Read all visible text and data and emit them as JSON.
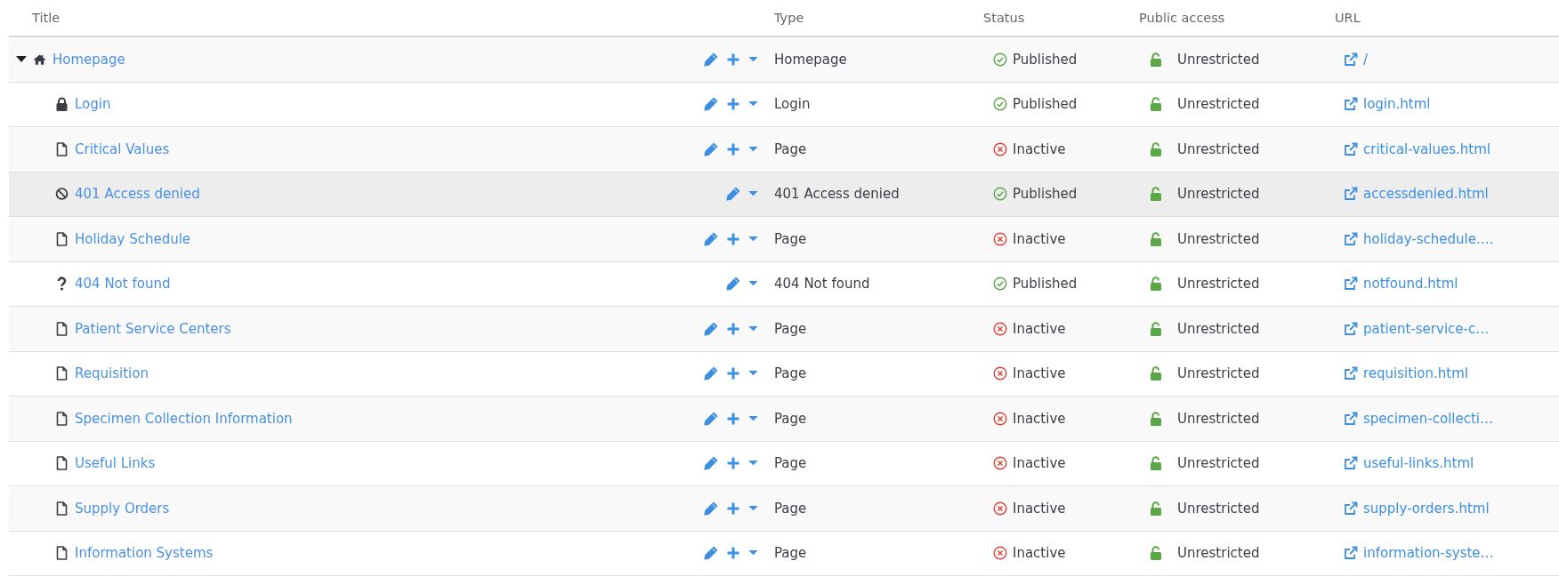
{
  "table": {
    "columns": [
      "Title",
      "Type",
      "Status",
      "Public access",
      "URL"
    ],
    "rows": [
      {
        "title": "Homepage",
        "kind": "home",
        "expanded": true,
        "can_add": true,
        "hovered": false,
        "type": "Homepage",
        "status": {
          "kind": "published",
          "label": "Published"
        },
        "access": "Unrestricted",
        "url": "/",
        "children": [
          {
            "title": "Login",
            "kind": "lock",
            "can_add": true,
            "hovered": false,
            "type": "Login",
            "status": {
              "kind": "published",
              "label": "Published"
            },
            "access": "Unrestricted",
            "url": "login.html"
          },
          {
            "title": "Critical Values",
            "kind": "page",
            "can_add": true,
            "hovered": false,
            "type": "Page",
            "status": {
              "kind": "inactive",
              "label": "Inactive"
            },
            "access": "Unrestricted",
            "url": "critical-values.html"
          },
          {
            "title": "401 Access denied",
            "kind": "ban",
            "can_add": false,
            "hovered": true,
            "type": "401 Access denied",
            "status": {
              "kind": "published",
              "label": "Published"
            },
            "access": "Unrestricted",
            "url": "accessdenied.html"
          },
          {
            "title": "Holiday Schedule",
            "kind": "page",
            "can_add": true,
            "hovered": false,
            "type": "Page",
            "status": {
              "kind": "inactive",
              "label": "Inactive"
            },
            "access": "Unrestricted",
            "url": "holiday-schedule.…"
          },
          {
            "title": "404 Not found",
            "kind": "question",
            "can_add": false,
            "hovered": false,
            "type": "404 Not found",
            "status": {
              "kind": "published",
              "label": "Published"
            },
            "access": "Unrestricted",
            "url": "notfound.html"
          },
          {
            "title": "Patient Service Centers",
            "kind": "page",
            "can_add": true,
            "hovered": false,
            "type": "Page",
            "status": {
              "kind": "inactive",
              "label": "Inactive"
            },
            "access": "Unrestricted",
            "url": "patient-service-c…"
          },
          {
            "title": "Requisition",
            "kind": "page",
            "can_add": true,
            "hovered": false,
            "type": "Page",
            "status": {
              "kind": "inactive",
              "label": "Inactive"
            },
            "access": "Unrestricted",
            "url": "requisition.html"
          },
          {
            "title": "Specimen Collection Information",
            "kind": "page",
            "can_add": true,
            "hovered": false,
            "type": "Page",
            "status": {
              "kind": "inactive",
              "label": "Inactive"
            },
            "access": "Unrestricted",
            "url": "specimen-collecti…"
          },
          {
            "title": "Useful Links",
            "kind": "page",
            "can_add": true,
            "hovered": false,
            "type": "Page",
            "status": {
              "kind": "inactive",
              "label": "Inactive"
            },
            "access": "Unrestricted",
            "url": "useful-links.html"
          },
          {
            "title": "Supply Orders",
            "kind": "page",
            "can_add": true,
            "hovered": false,
            "type": "Page",
            "status": {
              "kind": "inactive",
              "label": "Inactive"
            },
            "access": "Unrestricted",
            "url": "supply-orders.html"
          },
          {
            "title": "Information Systems",
            "kind": "page",
            "can_add": true,
            "hovered": false,
            "type": "Page",
            "status": {
              "kind": "inactive",
              "label": "Inactive"
            },
            "access": "Unrestricted",
            "url": "information-syste…"
          }
        ]
      }
    ]
  }
}
